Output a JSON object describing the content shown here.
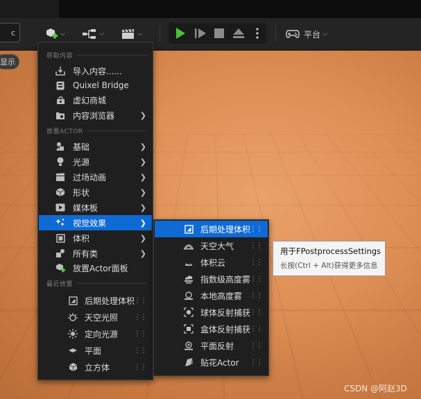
{
  "toolbar": {
    "platform_label": "平台"
  },
  "viewport": {
    "show_label": "显示"
  },
  "menu": {
    "sections": {
      "get_content": "获取内容",
      "place_actor": "放置ACTOR",
      "recent": "最近放置"
    },
    "get_content_items": [
      {
        "label": "导入内容......",
        "icon": "import-icon"
      },
      {
        "label": "Quixel Bridge",
        "icon": "bridge-icon"
      },
      {
        "label": "虚幻商城",
        "icon": "marketplace-icon"
      },
      {
        "label": "内容浏览器",
        "icon": "content-browser-icon"
      }
    ],
    "place_actor_items": [
      {
        "label": "基础",
        "icon": "basic-icon"
      },
      {
        "label": "光源",
        "icon": "light-icon"
      },
      {
        "label": "过场动画",
        "icon": "cinematic-icon"
      },
      {
        "label": "形状",
        "icon": "shape-icon"
      },
      {
        "label": "媒体板",
        "icon": "media-icon"
      },
      {
        "label": "视觉效果",
        "icon": "visual-effects-icon"
      },
      {
        "label": "体积",
        "icon": "volume-icon"
      },
      {
        "label": "所有类",
        "icon": "all-classes-icon"
      },
      {
        "label": "放置Actor面板",
        "icon": "place-actor-panel-icon"
      }
    ],
    "recent_items": [
      {
        "label": "后期处理体积"
      },
      {
        "label": "天空光照"
      },
      {
        "label": "定向光源"
      },
      {
        "label": "平面"
      },
      {
        "label": "立方体"
      }
    ]
  },
  "submenu": {
    "items": [
      {
        "label": "后期处理体积"
      },
      {
        "label": "天空大气"
      },
      {
        "label": "体积云"
      },
      {
        "label": "指数级高度雾"
      },
      {
        "label": "本地高度雾"
      },
      {
        "label": "球体反射捕获"
      },
      {
        "label": "盒体反射捕获"
      },
      {
        "label": "平面反射"
      },
      {
        "label": "贴花Actor"
      }
    ]
  },
  "tooltip": {
    "title": "用于FPostprocessSettings",
    "hint": "长按(Ctrl + Alt)获得更多信息"
  },
  "watermark": "CSDN @阿赵3D",
  "colors": {
    "selection": "#0f6ad4",
    "play_green": "#4cc23a",
    "viewport_orange": "#de9056"
  }
}
